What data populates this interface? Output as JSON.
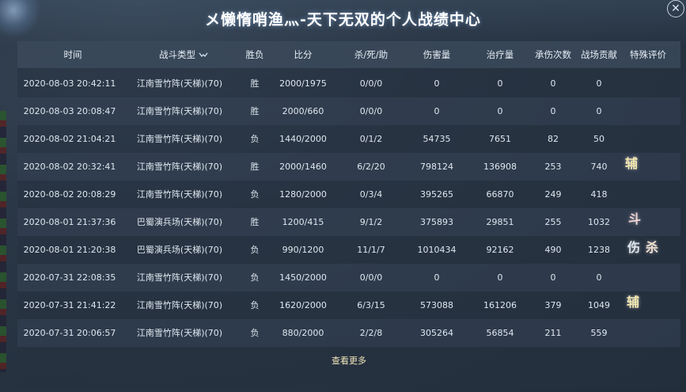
{
  "title": "メ懒惰哨渔灬-天下无双的个人战绩中心",
  "columns": [
    "时间",
    "战斗类型",
    "胜负",
    "比分",
    "杀/死/助",
    "伤害量",
    "治疗量",
    "承伤次数",
    "战场贡献",
    "特殊评价"
  ],
  "rows": [
    [
      "2020-08-03 20:42:11",
      "江南雪竹阵(天梯)(70)",
      "胜",
      "2000/1975",
      "0/0/0",
      "0",
      "0",
      "0",
      "0"
    ],
    [
      "2020-08-03 20:08:47",
      "江南雪竹阵(天梯)(70)",
      "胜",
      "2000/660",
      "0/0/0",
      "0",
      "0",
      "0",
      "0"
    ],
    [
      "2020-08-02 21:04:21",
      "江南雪竹阵(天梯)(70)",
      "负",
      "1440/2000",
      "0/1/2",
      "54735",
      "7651",
      "82",
      "50"
    ],
    [
      "2020-08-02 20:32:41",
      "江南雪竹阵(天梯)(70)",
      "胜",
      "2000/1460",
      "6/2/20",
      "798124",
      "136908",
      "253",
      "740"
    ],
    [
      "2020-08-02 20:08:29",
      "江南雪竹阵(天梯)(70)",
      "负",
      "1280/2000",
      "0/3/4",
      "395265",
      "66870",
      "249",
      "418"
    ],
    [
      "2020-08-01 21:37:36",
      "巴蜀演兵场(天梯)(70)",
      "胜",
      "1200/415",
      "9/1/2",
      "375893",
      "29851",
      "255",
      "1032"
    ],
    [
      "2020-08-01 21:20:38",
      "巴蜀演兵场(天梯)(70)",
      "负",
      "990/1200",
      "11/1/7",
      "1010434",
      "92162",
      "490",
      "1238"
    ],
    [
      "2020-07-31 22:08:35",
      "江南雪竹阵(天梯)(70)",
      "负",
      "1450/2000",
      "0/0/0",
      "0",
      "0",
      "0",
      "0"
    ],
    [
      "2020-07-31 21:41:22",
      "江南雪竹阵(天梯)(70)",
      "负",
      "1620/2000",
      "6/3/15",
      "573088",
      "161206",
      "379",
      "1049"
    ],
    [
      "2020-07-31 20:06:57",
      "江南雪竹阵(天梯)(70)",
      "负",
      "880/2000",
      "2/2/8",
      "305264",
      "56854",
      "211",
      "559"
    ]
  ],
  "badges": {
    "row4": "辅",
    "row6": "斗",
    "row7a": "伤",
    "row7b": "杀",
    "row9": "辅"
  },
  "more_label": "查看更多",
  "close_label": "✕",
  "icons": {
    "filter": "filter-chevron-icon",
    "close": "close-icon"
  }
}
